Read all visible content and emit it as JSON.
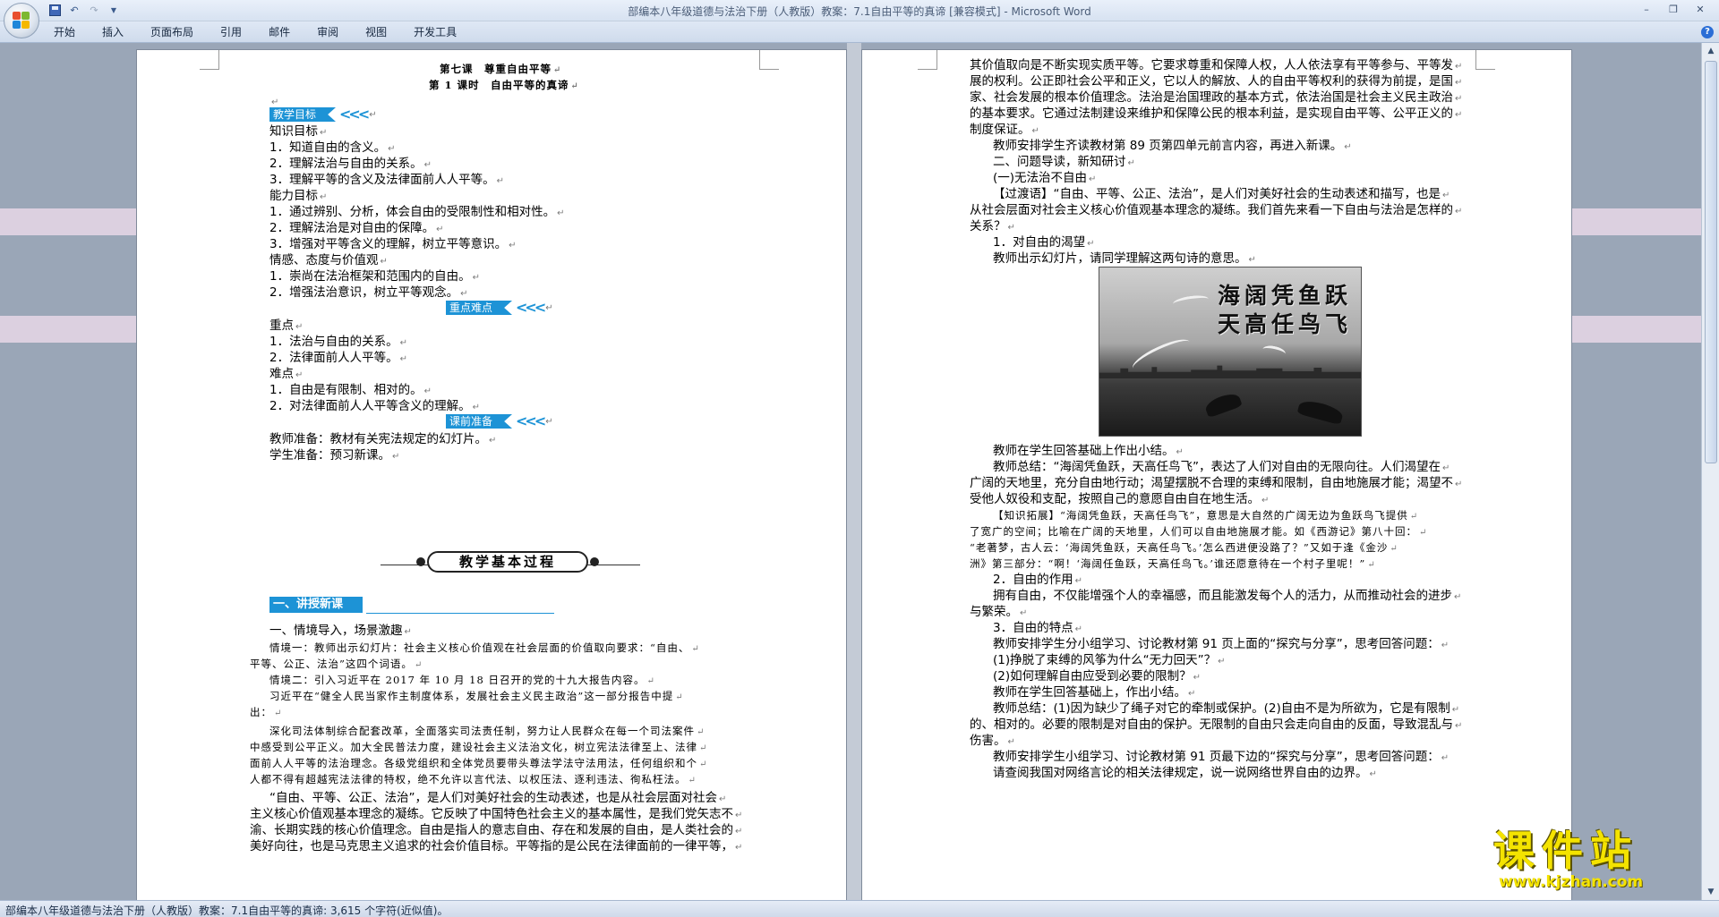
{
  "window": {
    "title": "部编本八年级道德与法治下册（人教版）教案：7.1自由平等的真谛 [兼容模式] - Microsoft Word"
  },
  "qat": {
    "save_icon": "save-icon",
    "undo_icon": "undo-icon",
    "redo_icon": "redo-icon",
    "customize_icon": "chevron-down-icon"
  },
  "window_controls": {
    "minimize": "–",
    "restore": "❐",
    "close": "✕"
  },
  "ribbon": {
    "tabs": [
      "开始",
      "插入",
      "页面布局",
      "引用",
      "邮件",
      "审阅",
      "视图",
      "开发工具"
    ],
    "help": "?"
  },
  "left_page": {
    "lesson_title": "第七课　尊重自由平等",
    "period_title": "第 1 课时　自由平等的真谛",
    "h_goals": "教学目标",
    "knowledge_label": "知识目标",
    "k1": "1．知道自由的含义。",
    "k2": "2．理解法治与自由的关系。",
    "k3": "3．理解平等的含义及法律面前人人平等。",
    "ability_label": "能力目标",
    "a1": "1．通过辨别、分析，体会自由的受限制性和相对性。",
    "a2": "2．理解法治是对自由的保障。",
    "a3": "3．增强对平等含义的理解，树立平等意识。",
    "emotion_label": "情感、态度与价值观",
    "e1": "1．崇尚在法治框架和范围内的自由。",
    "e2": "2．增强法治意识，树立平等观念。",
    "h_key": "重点难点",
    "key_label": "重点",
    "key1": "1．法治与自由的关系。",
    "key2": "2．法律面前人人平等。",
    "diff_label": "难点",
    "d1": "1．自由是有限制、相对的。",
    "d2": "2．对法律面前人人平等含义的理解。",
    "h_prep": "课前准备",
    "prep_teacher": "教师准备：教材有关宪法规定的幻灯片。",
    "prep_student": "学生准备：预习新课。",
    "process_title": "教学基本过程",
    "section_one": "一、讲授新课",
    "intro": "一、情境导入，场景激趣",
    "s1a": "情境一：教师出示幻灯片：社会主义核心价值观在社会层面的价值取向要求：“自由、",
    "s1b": "平等、公正、法治”这四个词语。",
    "s2": "情境二：引入习近平在 2017 年 10 月 18 日召开的党的十九大报告内容。",
    "s3a": "习近平在“健全人民当家作主制度体系，发展社会主义民主政治”这一部分报告中提",
    "s3b": "出：",
    "q1": "深化司法体制综合配套改革，全面落实司法责任制，努力让人民群众在每一个司法案件",
    "q2": "中感受到公平正义。加大全民普法力度，建设社会主义法治文化，树立宪法法律至上、法律",
    "q3": "面前人人平等的法治理念。各级党组织和全体党员要带头尊法学法守法用法，任何组织和个",
    "q4": "人都不得有超越宪法法律的特权，绝不允许以言代法、以权压法、逐利违法、徇私枉法。",
    "p1": "“自由、平等、公正、法治”，是人们对美好社会的生动表述，也是从社会层面对社会",
    "p2": "主义核心价值观基本理念的凝练。它反映了中国特色社会主义的基本属性，是我们党矢志不",
    "p3": "渝、长期实践的核心价值理念。自由是指人的意志自由、存在和发展的自由，是人类社会的",
    "p4": "美好向往，也是马克思主义追求的社会价值目标。平等指的是公民在法律面前的一律平等，"
  },
  "right_page": {
    "r1": "其价值取向是不断实现实质平等。它要求尊重和保障人权，人人依法享有平等参与、平等发",
    "r2": "展的权利。公正即社会公平和正义，它以人的解放、人的自由平等权利的获得为前提，是国",
    "r3": "家、社会发展的根本价值理念。法治是治国理政的基本方式，依法治国是社会主义民主政治",
    "r4": "的基本要求。它通过法制建设来维护和保障公民的根本利益，是实现自由平等、公平正义的",
    "r5": "制度保证。",
    "r6": "教师安排学生齐读教材第 89 页第四单元前言内容，再进入新课。",
    "r7": "二、问题导读，新知研讨",
    "r8": "(一)无法治不自由",
    "r9": "【过渡语】“自由、平等、公正、法治”，是人们对美好社会的生动表述和描写，也是",
    "r10": "从社会层面对社会主义核心价值观基本理念的凝练。我们首先来看一下自由与法治是怎样的",
    "r11": "关系？",
    "r12": "1．对自由的渴望",
    "r13": "教师出示幻灯片，请同学理解这两句诗的意思。",
    "img_line1": "海阔凭鱼跃",
    "img_line2": "天高任鸟飞",
    "r14": "教师在学生回答基础上作出小结。",
    "r15": "教师总结：“海阔凭鱼跃，天高任鸟飞”，表达了人们对自由的无限向往。人们渴望在",
    "r16": "广阔的天地里，充分自由地行动；渴望摆脱不合理的束缚和限制，自由地施展才能；渴望不",
    "r17": "受他人奴役和支配，按照自己的意愿自由自在地生活。",
    "r18": "【知识拓展】“海阔凭鱼跃，天高任鸟飞”，意思是大自然的广阔无边为鱼跃鸟飞提供",
    "r19": "了宽广的空间；比喻在广阔的天地里，人们可以自由地施展才能。如《西游记》第八十回：",
    "r20": "“老著梦，古人云：‘海阔凭鱼跃，天高任鸟飞。’怎么西进便没路了？”又如于逢《金沙",
    "r21": "洲》第三部分：“啊！‘海阔任鱼跃，天高任鸟飞。’谁还愿意待在一个村子里呢！”",
    "r22": "2．自由的作用",
    "r23": "拥有自由，不仅能增强个人的幸福感，而且能激发每个人的活力，从而推动社会的进步",
    "r24": "与繁荣。",
    "r25": "3．自由的特点",
    "r26": "教师安排学生分小组学习、讨论教材第 91 页上面的“探究与分享”，思考回答问题：",
    "r27": "(1)挣脱了束缚的风筝为什么“无力回天”？",
    "r28": "(2)如何理解自由应受到必要的限制？",
    "r29": "教师在学生回答基础上，作出小结。",
    "r30": "教师总结：(1)因为缺少了绳子对它的牵制或保护。(2)自由不是为所欲为，它是有限制",
    "r31": "的、相对的。必要的限制是对自由的保护。无限制的自由只会走向自由的反面，导致混乱与",
    "r32": "伤害。",
    "r33": "教师安排学生小组学习、讨论教材第 91 页最下边的“探究与分享”，思考回答问题：",
    "r34": "请查阅我国对网络言论的相关法律规定，说一说网络世界自由的边界。"
  },
  "status": {
    "text": "部编本八年级道德与法治下册（人教版）教案：7.1自由平等的真谛: 3,615 个字符(近似值)。"
  },
  "watermark": {
    "title": "课件站",
    "url": "www.kjzhan.com"
  },
  "colors": {
    "accent": "#1d93d6",
    "watermark": "#f4e300"
  }
}
